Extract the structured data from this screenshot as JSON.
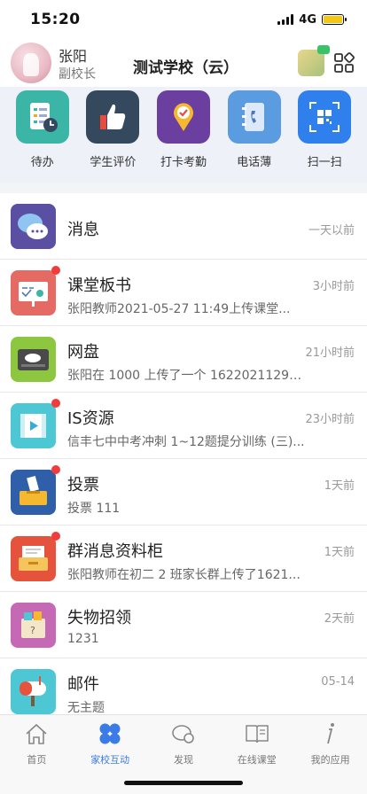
{
  "status": {
    "time": "15:20",
    "network": "4G"
  },
  "header": {
    "user_name": "张阳",
    "user_role": "副校长",
    "school": "测试学校（云）"
  },
  "quick_actions": [
    {
      "label": "待办",
      "icon": "todo-icon"
    },
    {
      "label": "学生评价",
      "icon": "thumbs-up-icon"
    },
    {
      "label": "打卡考勤",
      "icon": "location-check-icon"
    },
    {
      "label": "电话薄",
      "icon": "phone-book-icon"
    },
    {
      "label": "扫一扫",
      "icon": "qr-scan-icon"
    }
  ],
  "messages": [
    {
      "title": "消息",
      "subtitle": "",
      "time": "一天以前",
      "icon": "chat-bubble-icon",
      "unread": false
    },
    {
      "title": "课堂板书",
      "subtitle": "张阳教师2021-05-27 11:49上传课堂...",
      "time": "3小时前",
      "icon": "blackboard-icon",
      "unread": true
    },
    {
      "title": "网盘",
      "subtitle": "张阳在 1000 上传了一个 162202112922...",
      "time": "21小时前",
      "icon": "cloud-drive-icon",
      "unread": false
    },
    {
      "title": "IS资源",
      "subtitle": "信丰七中中考冲刺 1~12题提分训练 (三)...",
      "time": "23小时前",
      "icon": "video-resource-icon",
      "unread": true
    },
    {
      "title": "投票",
      "subtitle": "投票 111",
      "time": "1天前",
      "icon": "ballot-box-icon",
      "unread": true
    },
    {
      "title": "群消息资料柜",
      "subtitle": "张阳教师在初二 2 班家长群上传了1621...",
      "time": "1天前",
      "icon": "file-cabinet-icon",
      "unread": true
    },
    {
      "title": "失物招领",
      "subtitle": "1231",
      "time": "2天前",
      "icon": "lost-found-icon",
      "unread": false
    },
    {
      "title": "邮件",
      "subtitle": "无主题",
      "time": "05-14",
      "icon": "mailbox-icon",
      "unread": false
    }
  ],
  "tabs": [
    {
      "label": "首页",
      "icon": "home-icon",
      "active": false
    },
    {
      "label": "家校互动",
      "icon": "clover-icon",
      "active": true
    },
    {
      "label": "发现",
      "icon": "discover-icon",
      "active": false
    },
    {
      "label": "在线课堂",
      "icon": "open-book-icon",
      "active": false
    },
    {
      "label": "我的应用",
      "icon": "info-icon",
      "active": false
    }
  ],
  "colors": {
    "accent": "#3b7be8",
    "badge": "#f23b3b"
  }
}
